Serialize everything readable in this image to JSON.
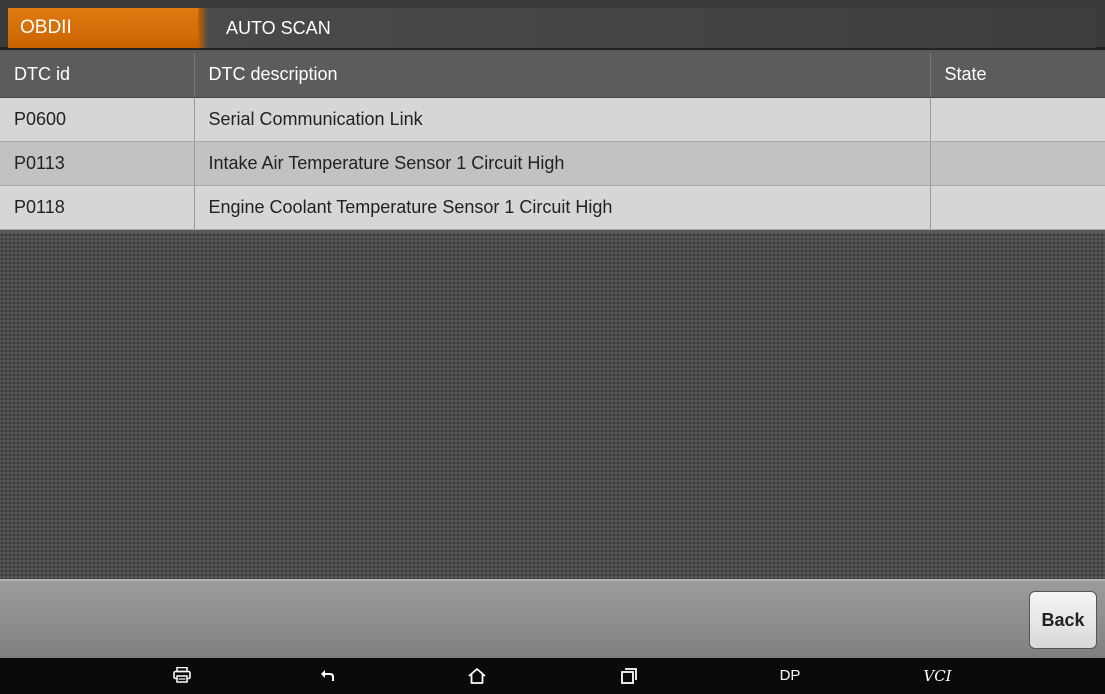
{
  "header": {
    "tab_obd": "OBDII",
    "tab_title": "AUTO SCAN"
  },
  "table": {
    "columns": [
      "DTC id",
      "DTC description",
      "State"
    ],
    "rows": [
      {
        "id": "P0600",
        "description": "Serial Communication Link",
        "state": ""
      },
      {
        "id": "P0113",
        "description": "Intake Air Temperature Sensor 1 Circuit High",
        "state": ""
      },
      {
        "id": "P0118",
        "description": "Engine Coolant Temperature Sensor 1 Circuit High",
        "state": ""
      }
    ]
  },
  "footer": {
    "back_label": "Back"
  },
  "navbar": {
    "icons": [
      "printer-icon",
      "back-arrow-icon",
      "home-icon",
      "recent-apps-icon"
    ],
    "dp_label": "DP",
    "vci_label": "VCI"
  },
  "colors": {
    "accent": "#d97000",
    "header_bg": "#5c5c5c",
    "row_light": "#d6d6d6",
    "row_dark": "#c2c2c2"
  }
}
